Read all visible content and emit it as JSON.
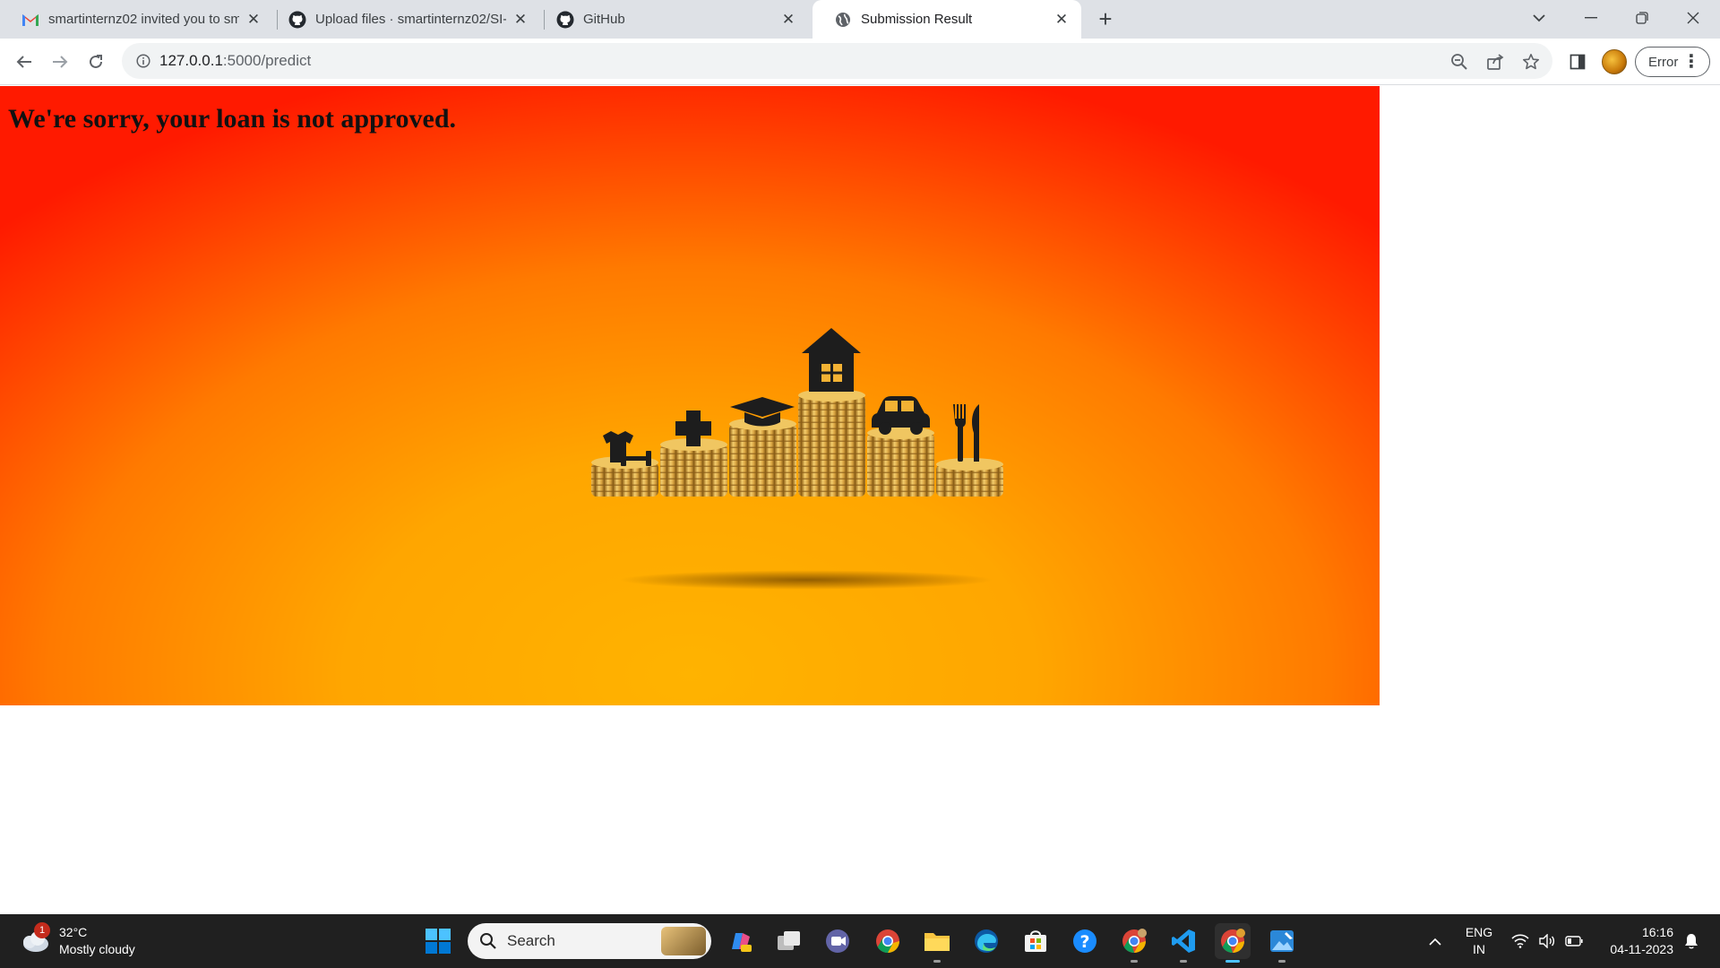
{
  "browser": {
    "tabs": [
      {
        "title": "smartinternz02 invited you to sm",
        "icon": "gmail-icon"
      },
      {
        "title": "Upload files · smartinternz02/SI-",
        "icon": "github-icon"
      },
      {
        "title": "GitHub",
        "icon": "github-icon"
      },
      {
        "title": "Submission Result",
        "icon": "globe-icon",
        "active": true
      }
    ],
    "address": {
      "host": "127.0.0.1",
      "path": ":5000/predict"
    },
    "profile_status": "Error"
  },
  "page": {
    "message": "We're sorry, your loan is not approved.",
    "illustration_icons": [
      "fitness-icon",
      "medical-cross-icon",
      "graduation-cap-icon",
      "house-icon",
      "car-icon",
      "cutlery-icon"
    ],
    "colors": {
      "gradient_top": "#ff1a00",
      "gradient_bottom": "#ffa600",
      "coin": "#d9a441"
    }
  },
  "taskbar": {
    "weather": {
      "temp": "32°C",
      "condition": "Mostly cloudy",
      "badge": "1"
    },
    "search_placeholder": "Search",
    "language": {
      "line1": "ENG",
      "line2": "IN"
    },
    "time": "16:16",
    "date": "04-11-2023"
  }
}
